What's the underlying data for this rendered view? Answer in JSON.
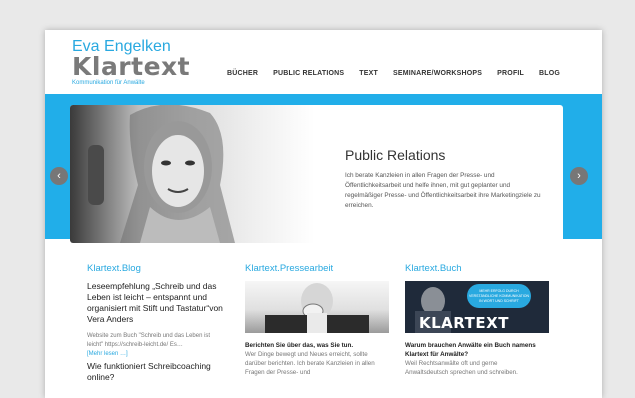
{
  "logo": {
    "top": "Eva Engelken",
    "main": "Klartext",
    "sub": "Kommunikation für Anwälte"
  },
  "nav": {
    "items": [
      "BÜCHER",
      "PUBLIC RELATIONS",
      "TEXT",
      "SEMINARE/WORKSHOPS",
      "PROFIL",
      "BLOG"
    ]
  },
  "slider": {
    "title": "Public Relations",
    "text": "Ich berate Kanzleien in allen Fragen der Presse- und Öffentlichkeitsarbeit und helfe ihnen, mit gut geplanter und regelmäßiger Presse- und Öffentlichkeitsarbeit ihre Marketingziele zu erreichen.",
    "prev_icon": "‹",
    "next_icon": "›"
  },
  "blog": {
    "heading": "Klartext.Blog",
    "post1_title": "Leseempfehlung „Schreib und das Leben ist leicht – entspannt und organisiert mit Stift und Tastatur“von Vera Anders",
    "post1_text": "Website zum Buch \"Schreib und das Leben ist leicht\" https://schreib-leicht.de/ Es…",
    "more": "[Mehr lesen …]",
    "post2_title": "Wie funktioniert Schreibcoaching online?"
  },
  "press": {
    "heading": "Klartext.Pressearbeit",
    "bold": "Berichten Sie über das, was Sie tun.",
    "text": "Wer Dinge bewegt und Neues erreicht, sollte darüber berichten. Ich berate Kanzleien in allen Fragen der Presse- und"
  },
  "book": {
    "heading": "Klartext.Buch",
    "banner": "MEHR ERFOLG DURCH VERSTÄNDLICHE KOMMUNIKATION IN WORT UND SCHRIFT",
    "cover_word": "KLARTEXT",
    "bold": "Warum brauchen Anwälte ein Buch namens Klartext für Anwälte?",
    "text": "Weil Rechtsanwälte oft und gerne Anwaltsdeutsch sprechen und schreiben."
  },
  "colors": {
    "accent": "#29a9e0",
    "band": "#21aee9"
  }
}
